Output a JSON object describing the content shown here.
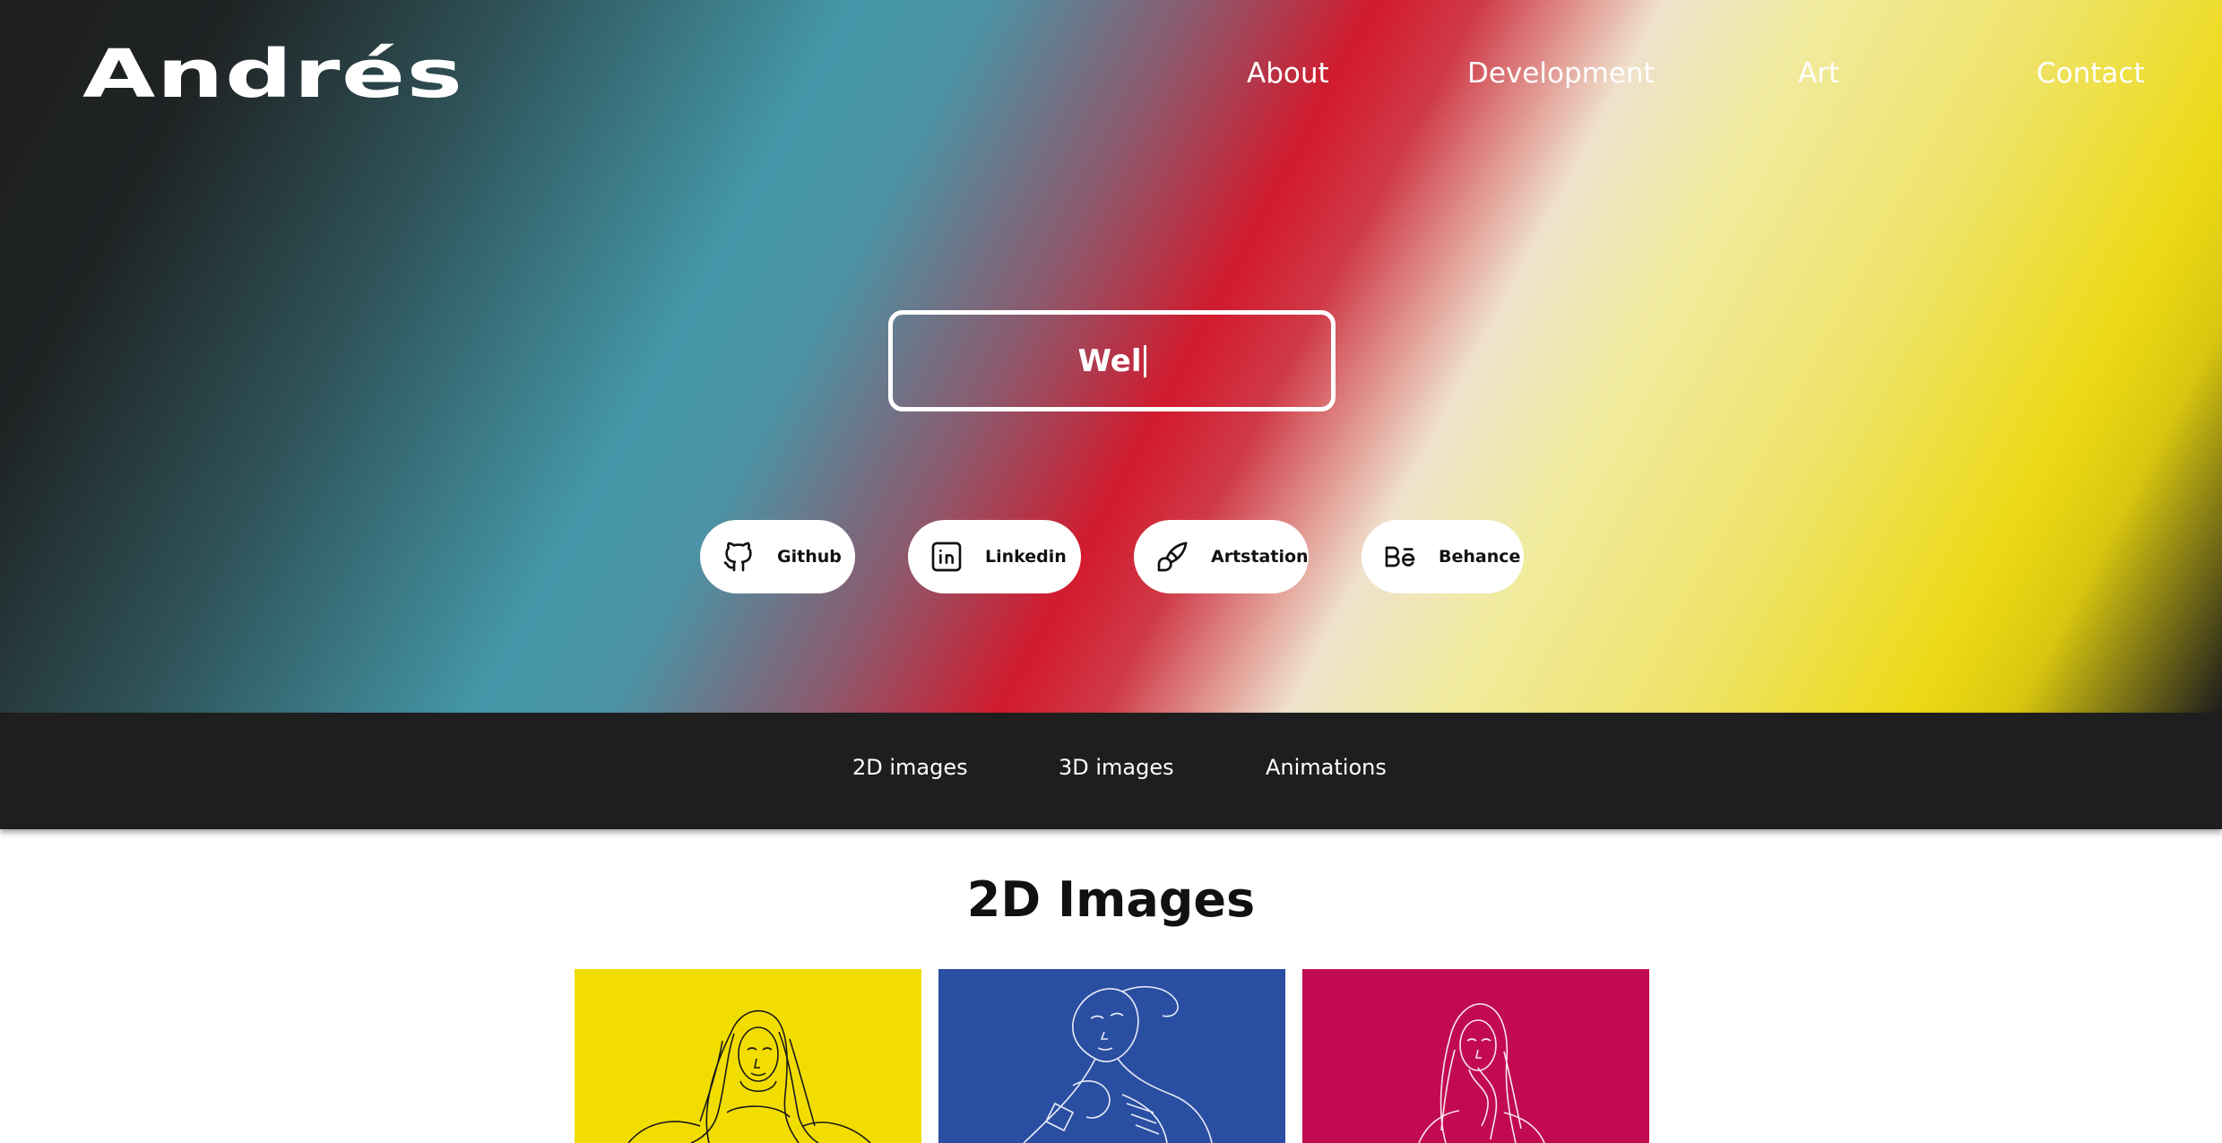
{
  "header": {
    "logo": "Andrés",
    "nav": {
      "about": "About",
      "development": "Development",
      "art": "Art",
      "contact": "Contact"
    }
  },
  "hero": {
    "typing_text": "Wel",
    "socials": [
      {
        "label": "Github",
        "icon": "github-icon"
      },
      {
        "label": "Linkedin",
        "icon": "linkedin-icon"
      },
      {
        "label": "Artstation",
        "icon": "brush-icon"
      },
      {
        "label": "Behance",
        "icon": "behance-icon"
      }
    ],
    "colors": {
      "dark": "#1e1e1e",
      "teal": "#4598a9",
      "red": "#d21a2d",
      "yellow": "#ecda16"
    }
  },
  "subnav": {
    "items": [
      "2D images",
      "3D images",
      "Animations"
    ]
  },
  "gallery": {
    "title": "2D Images",
    "tiles": [
      {
        "color": "#f2dd00",
        "line_color": "#1a1a1a",
        "icon": "portrait-illustration"
      },
      {
        "color": "#2a4ea2",
        "line_color": "#ffffff",
        "icon": "portrait-illustration"
      },
      {
        "color": "#c20a53",
        "line_color": "#ffffff",
        "icon": "portrait-illustration"
      }
    ]
  }
}
